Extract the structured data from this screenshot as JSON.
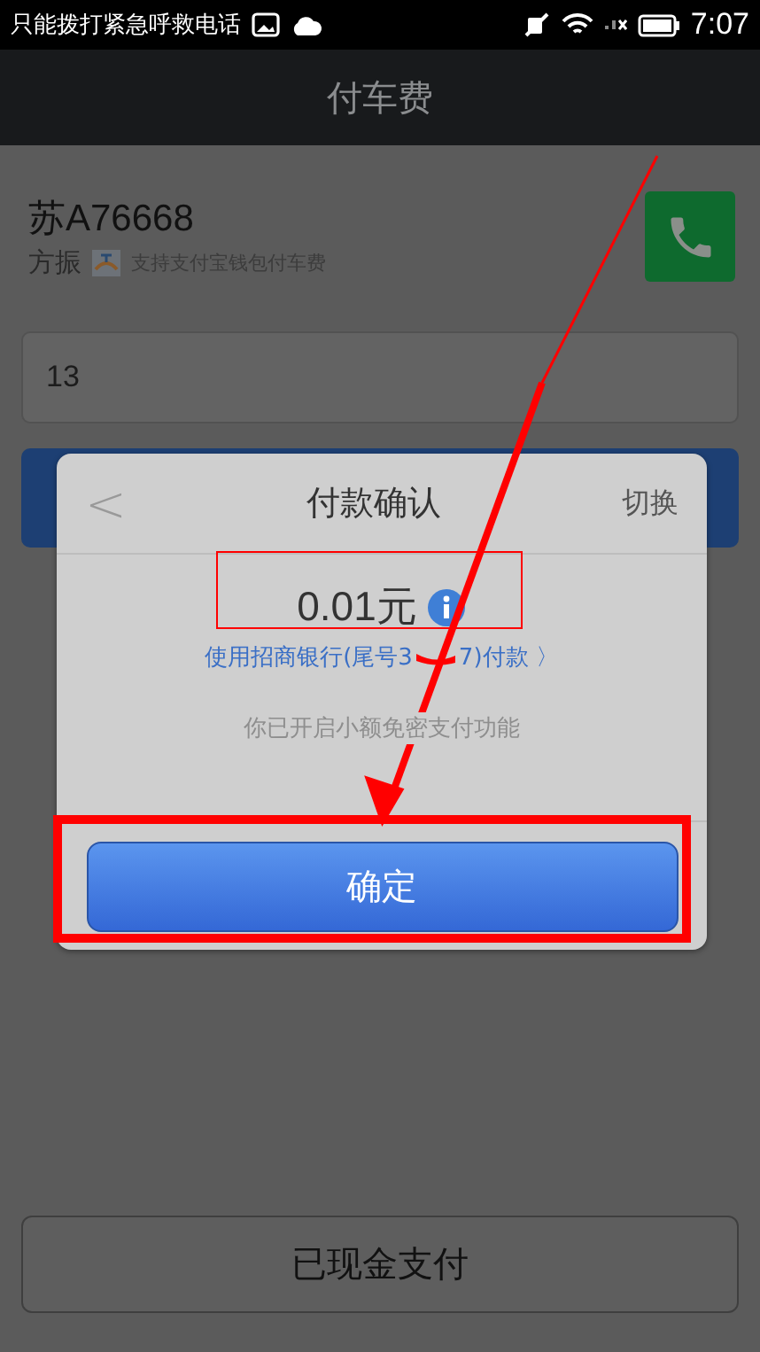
{
  "status_bar": {
    "carrier": "只能拨打紧急呼救电话",
    "time": "7:07"
  },
  "title_bar": {
    "title": "付车费"
  },
  "driver": {
    "plate": "苏A76668",
    "name": "方振",
    "note": "支持支付宝钱包付车费"
  },
  "amount_field": {
    "value": "13"
  },
  "dialog": {
    "back": "<",
    "title": "付款确认",
    "switch": "切换",
    "amount": "0.01元",
    "pay_method_before": "使用招商银行(尾号3",
    "pay_method_after": "7)付款 〉",
    "notice": "你已开启小额免密支付功能",
    "confirm": "确定"
  },
  "cash_button": "已现金支付"
}
